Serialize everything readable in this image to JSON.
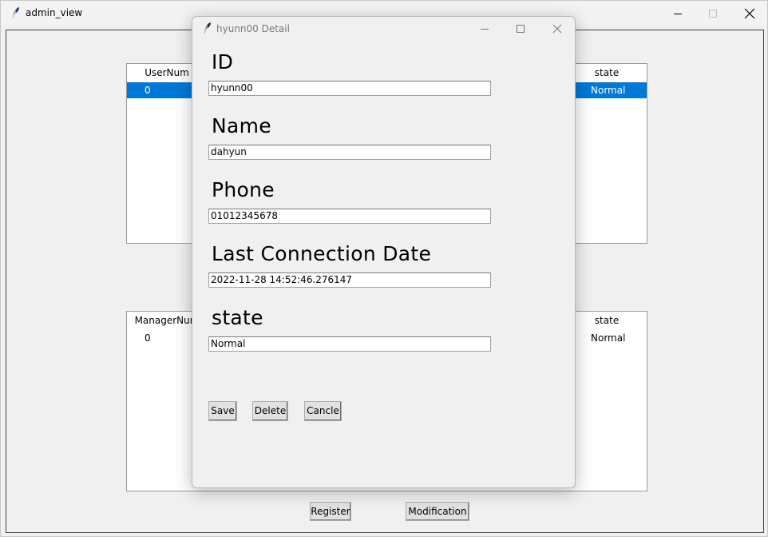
{
  "main_window": {
    "title": "admin_view"
  },
  "user_table": {
    "columns": [
      "UserNum",
      "state"
    ],
    "rows": [
      {
        "num": "0",
        "state": "Normal",
        "selected": true
      }
    ]
  },
  "manager_table": {
    "columns": [
      "ManagerNum",
      "state"
    ],
    "rows": [
      {
        "num": "0",
        "state": "Normal",
        "selected": false
      }
    ]
  },
  "main_buttons": {
    "register": "Register",
    "modification": "Modification"
  },
  "dialog": {
    "title": "hyunn00 Detail",
    "fields": [
      {
        "label": "ID",
        "value": "hyunn00"
      },
      {
        "label": "Name",
        "value": "dahyun"
      },
      {
        "label": "Phone",
        "value": "01012345678"
      },
      {
        "label": "Last Connection Date",
        "value": "2022-11-28 14:52:46.276147"
      },
      {
        "label": "state",
        "value": "Normal"
      }
    ],
    "buttons": {
      "save": "Save",
      "delete": "Delete",
      "cancel": "Cancle"
    }
  },
  "colors": {
    "selection": "#0078d7",
    "window_bg": "#f0f0f0"
  }
}
